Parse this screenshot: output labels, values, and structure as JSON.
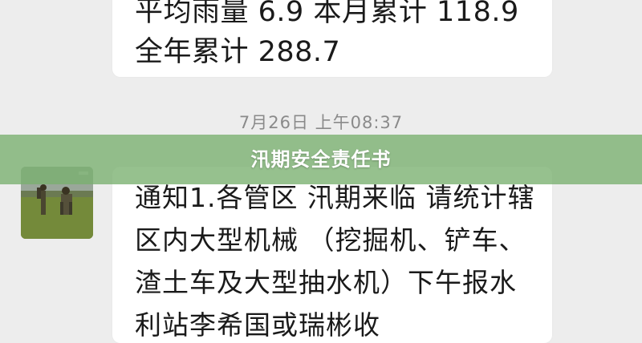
{
  "chat": {
    "prev_message": {
      "text": "平均雨量 6.9 本月累计 118.9 全年累计 288.7"
    },
    "timestamp": "7月26日 上午08:37",
    "message": {
      "text": "通知1.各管区 汛期来临 请统计辖区内大型机械 （挖掘机、铲车、渣土车及大型抽水机）下午报水利站李希国或瑞彬收"
    }
  },
  "banner": {
    "title": "汛期安全责任书"
  },
  "colors": {
    "banner_bg": "#78af6e",
    "chat_bg": "#ededed",
    "bubble_bg": "#ffffff"
  }
}
